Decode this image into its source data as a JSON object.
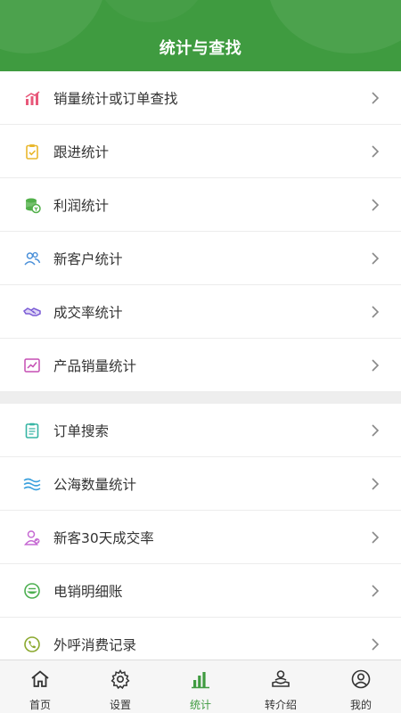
{
  "header": {
    "title": "统计与查找"
  },
  "sections": [
    {
      "items": [
        {
          "label": "销量统计或订单查找",
          "icon": "bar-chart-icon",
          "color": "#e8587a"
        },
        {
          "label": "跟进统计",
          "icon": "clipboard-check-icon",
          "color": "#e9b72c"
        },
        {
          "label": "利润统计",
          "icon": "coins-icon",
          "color": "#52b04a"
        },
        {
          "label": "新客户统计",
          "icon": "users-icon",
          "color": "#4a90d9"
        },
        {
          "label": "成交率统计",
          "icon": "handshake-icon",
          "color": "#7b5cd6"
        },
        {
          "label": "产品销量统计",
          "icon": "trend-chart-icon",
          "color": "#c54fb4"
        }
      ]
    },
    {
      "items": [
        {
          "label": "订单搜索",
          "icon": "document-icon",
          "color": "#37b5a4"
        },
        {
          "label": "公海数量统计",
          "icon": "waves-icon",
          "color": "#3aa0dd"
        },
        {
          "label": "新客30天成交率",
          "icon": "user-badge-icon",
          "color": "#c66ad3"
        },
        {
          "label": "电销明细账",
          "icon": "bowl-icon",
          "color": "#4caf50"
        },
        {
          "label": "外呼消费记录",
          "icon": "phone-clock-icon",
          "color": "#8aa82d"
        }
      ]
    }
  ],
  "nav": [
    {
      "label": "首页",
      "icon": "home-icon",
      "active": false
    },
    {
      "label": "设置",
      "icon": "gear-icon",
      "active": false
    },
    {
      "label": "统计",
      "icon": "stats-icon",
      "active": true
    },
    {
      "label": "转介绍",
      "icon": "referral-icon",
      "active": false
    },
    {
      "label": "我的",
      "icon": "profile-icon",
      "active": false
    }
  ],
  "colors": {
    "brand": "#3f9b40",
    "chevron": "#888888"
  }
}
